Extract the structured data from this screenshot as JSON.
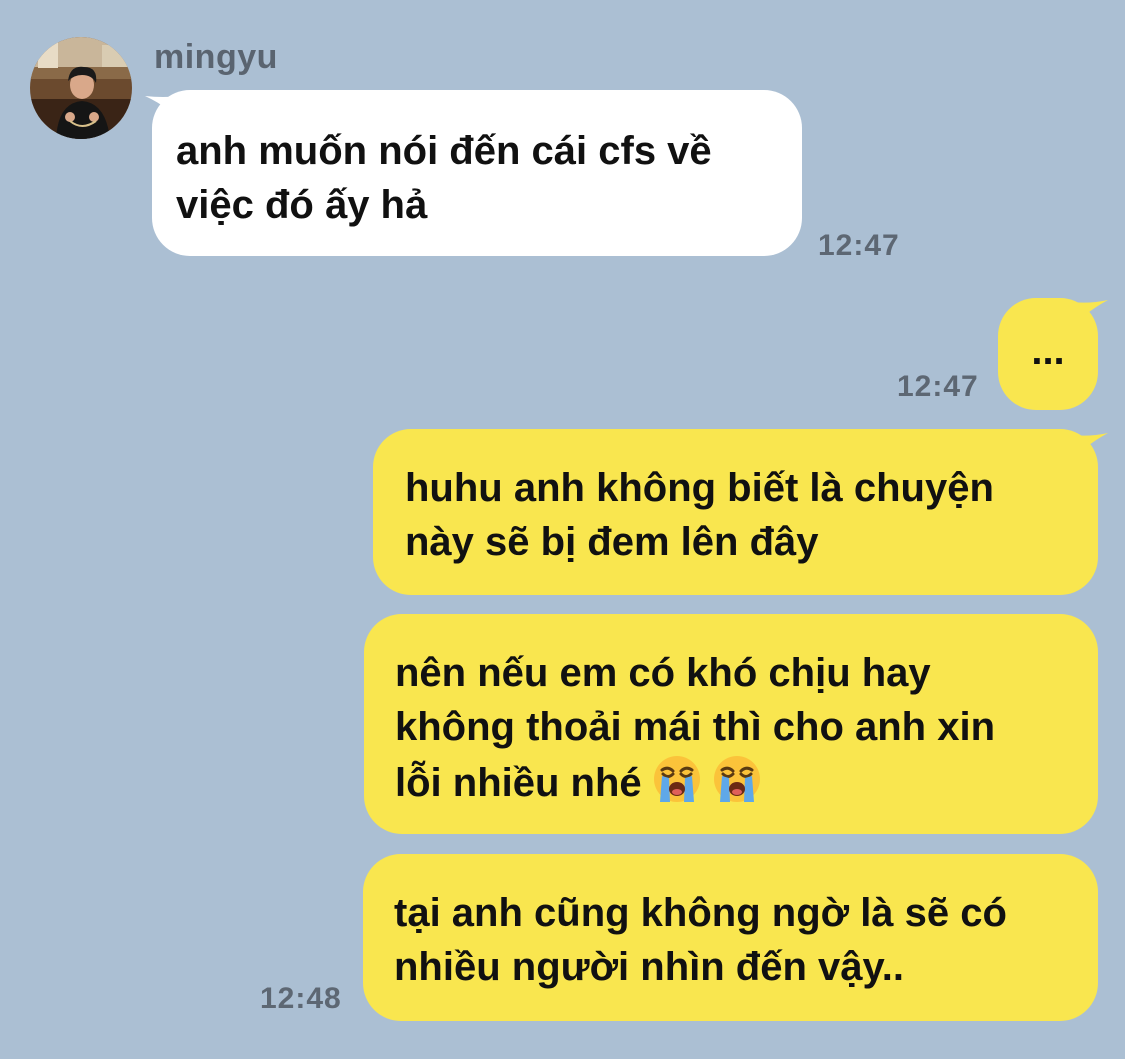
{
  "contact": {
    "name": "mingyu",
    "avatar_icon": "profile-photo-avatar"
  },
  "colors": {
    "background": "#abbfd3",
    "incoming_bubble": "#ffffff",
    "outgoing_bubble": "#f9e64f",
    "timestamp": "#5d6773"
  },
  "messages": [
    {
      "direction": "incoming",
      "text": "anh muốn nói đến cái cfs về\nviệc đó ấy hả",
      "time": "12:47"
    },
    {
      "direction": "outgoing",
      "text": "...",
      "time": "12:47"
    },
    {
      "direction": "outgoing",
      "text": "huhu anh không biết là chuyện\nnày sẽ bị đem lên đây",
      "time": ""
    },
    {
      "direction": "outgoing",
      "text": "nên nếu em có khó chịu hay\nkhông thoải mái thì cho anh xin\nlỗi nhiều nhé",
      "emojis": [
        "loudly-crying-face-emoji",
        "loudly-crying-face-emoji"
      ],
      "time": ""
    },
    {
      "direction": "outgoing",
      "text": "tại anh cũng không ngờ là sẽ có\nnhiều người nhìn đến vậy..",
      "time": "12:48"
    }
  ]
}
